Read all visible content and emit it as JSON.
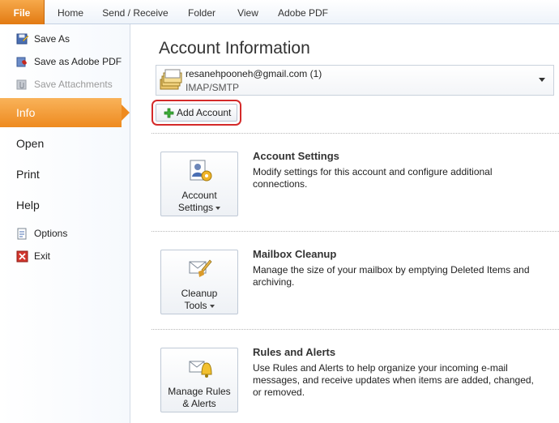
{
  "ribbon": {
    "tabs": [
      {
        "label": "File"
      },
      {
        "label": "Home"
      },
      {
        "label": "Send / Receive"
      },
      {
        "label": "Folder"
      },
      {
        "label": "View"
      },
      {
        "label": "Adobe PDF"
      }
    ]
  },
  "nav": {
    "commands_top": [
      {
        "label": "Save As",
        "icon": "save-as-icon"
      },
      {
        "label": "Save as Adobe PDF",
        "icon": "adobe-pdf-icon"
      },
      {
        "label": "Save Attachments",
        "icon": "attachment-icon",
        "disabled": true
      }
    ],
    "tabs": [
      {
        "label": "Info",
        "active": true
      },
      {
        "label": "Open"
      },
      {
        "label": "Print"
      },
      {
        "label": "Help"
      }
    ],
    "commands_bottom": [
      {
        "label": "Options",
        "icon": "options-icon"
      },
      {
        "label": "Exit",
        "icon": "exit-icon"
      }
    ]
  },
  "main": {
    "title": "Account Information",
    "account": {
      "email": "resanehpooneh@gmail.com (1)",
      "type": "IMAP/SMTP",
      "icon": "mail-folders-icon"
    },
    "add_account_label": "Add Account",
    "sections": [
      {
        "button_line1": "Account",
        "button_line2": "Settings",
        "icon": "account-settings-icon",
        "title": "Account Settings",
        "description": "Modify settings for this account and configure additional connections."
      },
      {
        "button_line1": "Cleanup",
        "button_line2": "Tools",
        "icon": "cleanup-tools-icon",
        "title": "Mailbox Cleanup",
        "description": "Manage the size of your mailbox by emptying Deleted Items and archiving."
      },
      {
        "button_line1": "Manage Rules",
        "button_line2": "& Alerts",
        "icon": "rules-alerts-icon",
        "title": "Rules and Alerts",
        "description": "Use Rules and Alerts to help organize your incoming e-mail messages, and receive updates when items are added, changed, or removed."
      }
    ]
  },
  "colors": {
    "file_tab": "#e27a12",
    "active_nav": "#ee8a1f",
    "highlight_ring": "#d42a2a"
  }
}
